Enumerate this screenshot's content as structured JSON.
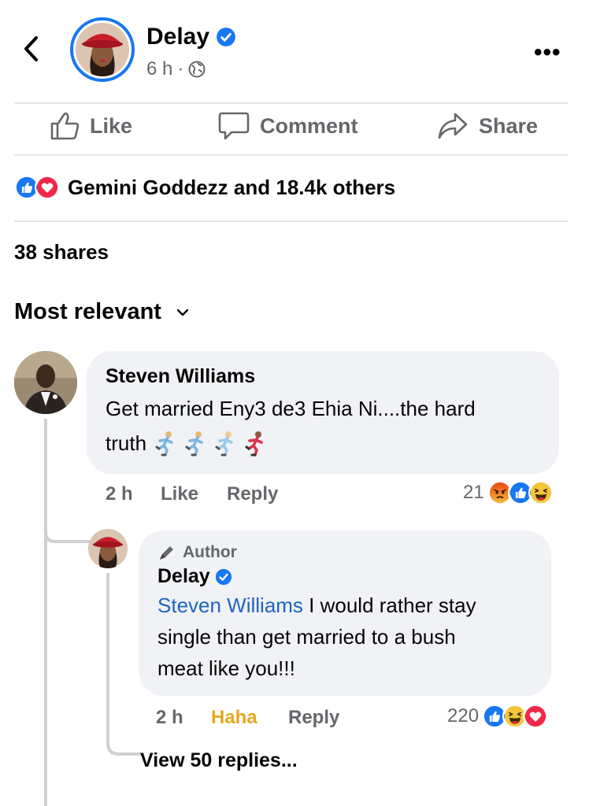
{
  "post": {
    "author": "Delay",
    "time": "6 h"
  },
  "actions": {
    "like": "Like",
    "comment": "Comment",
    "share": "Share"
  },
  "reactions_summary": "Gemini Goddezz and 18.4k others",
  "shares": "38 shares",
  "sort_label": "Most relevant",
  "comments": [
    {
      "author": "Steven Williams",
      "text_line1": "Get married Eny3 de3 Ehia Ni....the hard",
      "text_line2": "truth",
      "time": "2 h",
      "like": "Like",
      "reply": "Reply",
      "reaction_count": "21"
    }
  ],
  "reply": {
    "badge": "Author",
    "author": "Delay",
    "mention": "Steven Williams",
    "text_line1": " I would rather stay",
    "text_line2": "single than get married to a bush",
    "text_line3": "meat like you!!!",
    "time": "2 h",
    "reaction_label": "Haha",
    "reply": "Reply",
    "reaction_count": "220"
  },
  "view_replies": "View 50 replies...",
  "colors": {
    "accent": "#1877f2",
    "haha": "#e6a81f",
    "love": "#f0284a",
    "angry": "#e9710f"
  },
  "icons": [
    "back-chevron-icon",
    "verified-badge-icon",
    "globe-icon",
    "more-icon",
    "like-thumb-icon",
    "comment-bubble-icon",
    "share-arrow-icon",
    "like-reaction-icon",
    "love-reaction-icon",
    "angry-reaction-icon",
    "haha-reaction-icon",
    "runner-emoji-icon",
    "author-pen-icon",
    "chevron-down-icon"
  ]
}
